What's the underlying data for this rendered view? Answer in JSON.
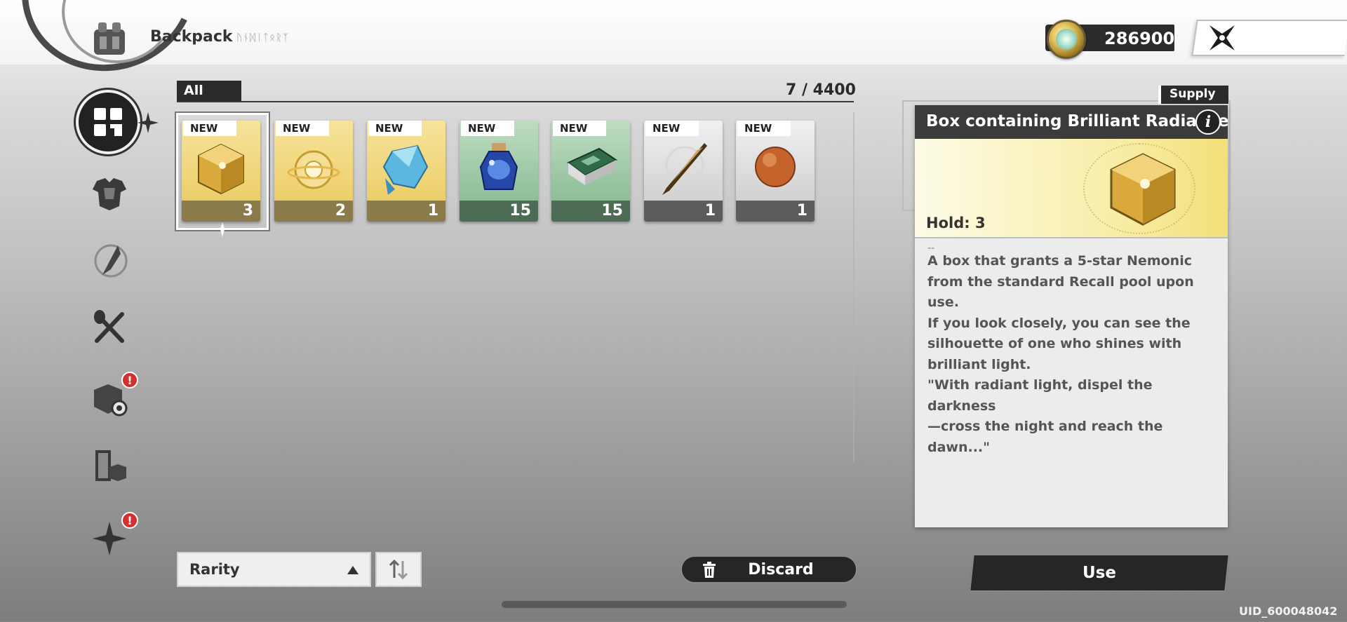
{
  "header": {
    "title": "Backpack",
    "subtitle_script": "ᚢᚾᛞᛁᛏᛟᚱᛉ",
    "currency_value": "286900"
  },
  "sidebar": {
    "items": [
      {
        "name": "all-items",
        "icon": "grid-icon",
        "active": true
      },
      {
        "name": "armor",
        "icon": "armor-icon"
      },
      {
        "name": "materials",
        "icon": "feather-icon"
      },
      {
        "name": "food",
        "icon": "utensils-icon"
      },
      {
        "name": "gear-boxes",
        "icon": "box-gear-icon",
        "alert": "!"
      },
      {
        "name": "furniture",
        "icon": "door-box-icon"
      },
      {
        "name": "special",
        "icon": "star-icon",
        "alert": "!"
      }
    ]
  },
  "inventory": {
    "filter_label": "All",
    "count": "7 / 4400",
    "items": [
      {
        "badge": "NEW",
        "qty": "3",
        "rarity": "gold",
        "icon": "golden-cube-icon"
      },
      {
        "badge": "NEW",
        "qty": "2",
        "rarity": "gold",
        "icon": "golden-orb-icon"
      },
      {
        "badge": "NEW",
        "qty": "1",
        "rarity": "gold",
        "icon": "blue-crystal-icon"
      },
      {
        "badge": "NEW",
        "qty": "15",
        "rarity": "green",
        "icon": "potion-jar-icon"
      },
      {
        "badge": "NEW",
        "qty": "15",
        "rarity": "green",
        "icon": "book-icon"
      },
      {
        "badge": "NEW",
        "qty": "1",
        "rarity": "gray",
        "icon": "quill-icon"
      },
      {
        "badge": "NEW",
        "qty": "1",
        "rarity": "gray",
        "icon": "copper-ball-icon"
      }
    ]
  },
  "controls": {
    "sort_label": "Rarity",
    "discard_label": "Discard",
    "use_label": "Use"
  },
  "detail": {
    "category": "Supply",
    "name": "Box containing Brilliant Radiance",
    "hold": "Hold: 3",
    "dash": "--",
    "description": "A box that grants a 5-star Nemonic\nfrom the standard Recall pool upon use.\nIf you look closely, you can see the\nsilhouette of one who shines with\nbrilliant light.\n\"With radiant light, dispel the darkness\n—cross the night and reach the dawn...\""
  },
  "footer": {
    "uid": "UID_600048042"
  },
  "colors": {
    "gold_card": "#e9c95d",
    "green_card": "#7fb68c",
    "gray_card": "#c9c9c9",
    "dark_panel": "#2b2b2b",
    "alert_red": "#d23030"
  }
}
